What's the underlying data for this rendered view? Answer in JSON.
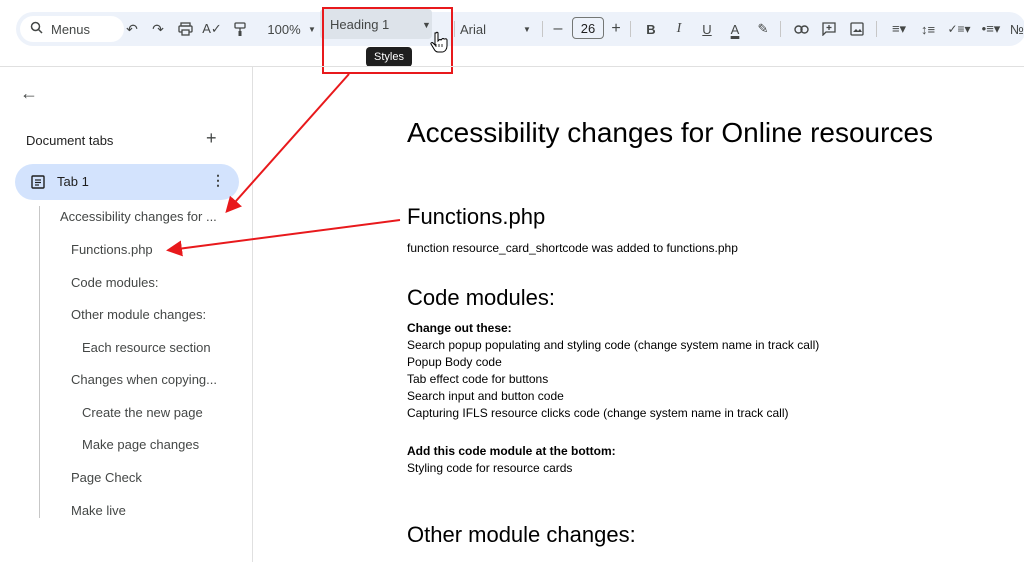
{
  "toolbar": {
    "menus_label": "Menus",
    "zoom": "100%",
    "style_value": "Heading 1",
    "tooltip": "Styles",
    "font": "Arial",
    "font_size": "26",
    "bold": "B",
    "italic": "I",
    "underline": "U",
    "text_color": "A"
  },
  "sidebar": {
    "tabs_heading": "Document tabs",
    "tab_label": "Tab 1",
    "outline": [
      "Accessibility changes for ...",
      "Functions.php",
      "Code modules:",
      "Other module changes:",
      "Each resource section",
      "Changes when copying...",
      "Create the new page",
      "Make page changes",
      "Page Check",
      "Make live"
    ]
  },
  "doc": {
    "title": "Accessibility changes for Online resources",
    "h_functions": "Functions.php",
    "p_functions": "function resource_card_shortcode was added to functions.php",
    "h_code": "Code modules:",
    "change_heading": "Change out these:",
    "change_items": [
      "Search popup populating and styling code (change system name in track call)",
      "Popup Body code",
      "Tab effect code for buttons",
      "Search input and button code",
      "Capturing IFLS resource clicks code (change system name in track call)"
    ],
    "add_heading": "Add this code module at the bottom:",
    "add_item": "Styling code for resource cards",
    "h_other": "Other module changes:"
  },
  "colors": {
    "accent": "#d3e3fd",
    "annotation": "#e8191c",
    "toolbar_bg": "#edf2fa"
  }
}
